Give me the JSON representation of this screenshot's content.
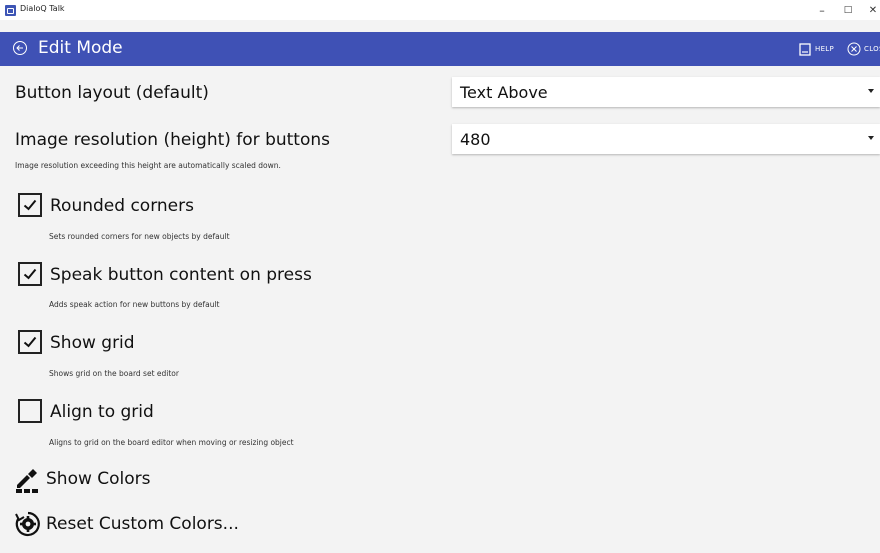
{
  "window": {
    "title": "DialoQ Talk",
    "minimize": "–",
    "maximize": "□",
    "close": "✕"
  },
  "header": {
    "title": "Edit Mode",
    "help_label": "HELP",
    "close_label": "CLOSE",
    "background": "#3f51b5"
  },
  "settings": {
    "button_layout": {
      "label": "Button layout (default)",
      "value": "Text Above"
    },
    "image_resolution": {
      "label": "Image resolution (height) for buttons",
      "value": "480",
      "hint": "Image resolution exceeding this height are automatically scaled down."
    },
    "checkboxes": [
      {
        "label": "Rounded corners",
        "hint": "Sets rounded corners for new objects by default",
        "checked": true
      },
      {
        "label": "Speak button content on press",
        "hint": "Adds speak action for new buttons by default",
        "checked": true
      },
      {
        "label": "Show grid",
        "hint": "Shows grid on the board set editor",
        "checked": true
      },
      {
        "label": "Align to grid",
        "hint": "Aligns to grid on the board editor when moving or resizing object",
        "checked": false
      }
    ],
    "actions": [
      {
        "label": "Show Colors",
        "icon": "color-picker-icon"
      },
      {
        "label": "Reset Custom Colors...",
        "icon": "reset-gear-icon"
      }
    ]
  }
}
